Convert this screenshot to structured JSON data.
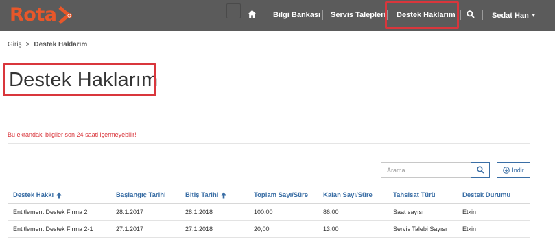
{
  "app": {
    "logo_text": "Rota",
    "brand_color": "#e8572a"
  },
  "nav": {
    "home_icon": "home-icon",
    "items": [
      {
        "label": "Bilgi Bankası"
      },
      {
        "label": "Servis Talepleri"
      },
      {
        "label": "Destek Haklarım"
      }
    ],
    "search_icon": "search-icon",
    "user_label": "Sedat Han",
    "user_caret": "▾"
  },
  "breadcrumb": {
    "home": "Giriş",
    "separator": ">",
    "current": "Destek Haklarım"
  },
  "page": {
    "title": "Destek Haklarım",
    "warning": "Bu ekrandaki bilgiler son 24 saati içermeyebilir!"
  },
  "toolbar": {
    "search_placeholder": "Arama",
    "search_value": "",
    "download_label": "İndir"
  },
  "table": {
    "columns": [
      {
        "label": "Destek Hakkı",
        "sorted": true
      },
      {
        "label": "Başlangıç Tarihi",
        "sorted": false
      },
      {
        "label": "Bitiş Tarihi",
        "sorted": true
      },
      {
        "label": "Toplam Sayı/Süre",
        "sorted": false
      },
      {
        "label": "Kalan Sayı/Süre",
        "sorted": false
      },
      {
        "label": "Tahsisat Türü",
        "sorted": false
      },
      {
        "label": "Destek Durumu",
        "sorted": false
      }
    ],
    "rows": [
      [
        "Entitlement Destek Firma 2",
        "28.1.2017",
        "28.1.2018",
        "100,00",
        "86,00",
        "Saat sayısı",
        "Etkin"
      ],
      [
        "Entitlement Destek Firma 2-1",
        "27.1.2017",
        "27.1.2018",
        "20,00",
        "13,00",
        "Servis Talebi Sayısı",
        "Etkin"
      ]
    ]
  },
  "colors": {
    "topbar": "#5b5b5b",
    "link": "#3a6ea5",
    "warning": "#d9363c",
    "highlight": "#d9363c"
  }
}
